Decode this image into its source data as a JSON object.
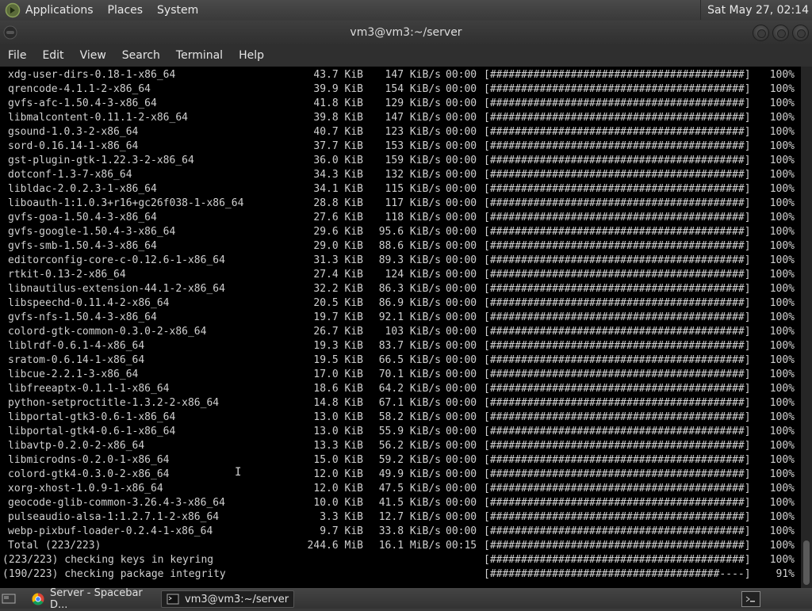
{
  "top_panel": {
    "menus": [
      "Applications",
      "Places",
      "System"
    ],
    "clock": "Sat May 27, 02:14"
  },
  "window": {
    "title": "vm3@vm3:~/server",
    "menu": [
      "File",
      "Edit",
      "View",
      "Search",
      "Terminal",
      "Help"
    ]
  },
  "terminal": {
    "rows": [
      {
        "name": "xdg-user-dirs-0.18-1-x86_64",
        "size": "43.7 KiB",
        "speed": "147 KiB/s",
        "time": "00:00",
        "bar": "[#########################################]",
        "pct": "100%"
      },
      {
        "name": "qrencode-4.1.1-2-x86_64",
        "size": "39.9 KiB",
        "speed": "154 KiB/s",
        "time": "00:00",
        "bar": "[#########################################]",
        "pct": "100%"
      },
      {
        "name": "gvfs-afc-1.50.4-3-x86_64",
        "size": "41.8 KiB",
        "speed": "129 KiB/s",
        "time": "00:00",
        "bar": "[#########################################]",
        "pct": "100%"
      },
      {
        "name": "libmalcontent-0.11.1-2-x86_64",
        "size": "39.8 KiB",
        "speed": "147 KiB/s",
        "time": "00:00",
        "bar": "[#########################################]",
        "pct": "100%"
      },
      {
        "name": "gsound-1.0.3-2-x86_64",
        "size": "40.7 KiB",
        "speed": "123 KiB/s",
        "time": "00:00",
        "bar": "[#########################################]",
        "pct": "100%"
      },
      {
        "name": "sord-0.16.14-1-x86_64",
        "size": "37.7 KiB",
        "speed": "153 KiB/s",
        "time": "00:00",
        "bar": "[#########################################]",
        "pct": "100%"
      },
      {
        "name": "gst-plugin-gtk-1.22.3-2-x86_64",
        "size": "36.0 KiB",
        "speed": "159 KiB/s",
        "time": "00:00",
        "bar": "[#########################################]",
        "pct": "100%"
      },
      {
        "name": "dotconf-1.3-7-x86_64",
        "size": "34.3 KiB",
        "speed": "132 KiB/s",
        "time": "00:00",
        "bar": "[#########################################]",
        "pct": "100%"
      },
      {
        "name": "libldac-2.0.2.3-1-x86_64",
        "size": "34.1 KiB",
        "speed": "115 KiB/s",
        "time": "00:00",
        "bar": "[#########################################]",
        "pct": "100%"
      },
      {
        "name": "liboauth-1:1.0.3+r16+gc26f038-1-x86_64",
        "size": "28.8 KiB",
        "speed": "117 KiB/s",
        "time": "00:00",
        "bar": "[#########################################]",
        "pct": "100%"
      },
      {
        "name": "gvfs-goa-1.50.4-3-x86_64",
        "size": "27.6 KiB",
        "speed": "118 KiB/s",
        "time": "00:00",
        "bar": "[#########################################]",
        "pct": "100%"
      },
      {
        "name": "gvfs-google-1.50.4-3-x86_64",
        "size": "29.6 KiB",
        "speed": "95.6 KiB/s",
        "time": "00:00",
        "bar": "[#########################################]",
        "pct": "100%"
      },
      {
        "name": "gvfs-smb-1.50.4-3-x86_64",
        "size": "29.0 KiB",
        "speed": "88.6 KiB/s",
        "time": "00:00",
        "bar": "[#########################################]",
        "pct": "100%"
      },
      {
        "name": "editorconfig-core-c-0.12.6-1-x86_64",
        "size": "31.3 KiB",
        "speed": "89.3 KiB/s",
        "time": "00:00",
        "bar": "[#########################################]",
        "pct": "100%"
      },
      {
        "name": "rtkit-0.13-2-x86_64",
        "size": "27.4 KiB",
        "speed": "124 KiB/s",
        "time": "00:00",
        "bar": "[#########################################]",
        "pct": "100%"
      },
      {
        "name": "libnautilus-extension-44.1-2-x86_64",
        "size": "32.2 KiB",
        "speed": "86.3 KiB/s",
        "time": "00:00",
        "bar": "[#########################################]",
        "pct": "100%"
      },
      {
        "name": "libspeechd-0.11.4-2-x86_64",
        "size": "20.5 KiB",
        "speed": "86.9 KiB/s",
        "time": "00:00",
        "bar": "[#########################################]",
        "pct": "100%"
      },
      {
        "name": "gvfs-nfs-1.50.4-3-x86_64",
        "size": "19.7 KiB",
        "speed": "92.1 KiB/s",
        "time": "00:00",
        "bar": "[#########################################]",
        "pct": "100%"
      },
      {
        "name": "colord-gtk-common-0.3.0-2-x86_64",
        "size": "26.7 KiB",
        "speed": "103 KiB/s",
        "time": "00:00",
        "bar": "[#########################################]",
        "pct": "100%"
      },
      {
        "name": "liblrdf-0.6.1-4-x86_64",
        "size": "19.3 KiB",
        "speed": "83.7 KiB/s",
        "time": "00:00",
        "bar": "[#########################################]",
        "pct": "100%"
      },
      {
        "name": "sratom-0.6.14-1-x86_64",
        "size": "19.5 KiB",
        "speed": "66.5 KiB/s",
        "time": "00:00",
        "bar": "[#########################################]",
        "pct": "100%"
      },
      {
        "name": "libcue-2.2.1-3-x86_64",
        "size": "17.0 KiB",
        "speed": "70.1 KiB/s",
        "time": "00:00",
        "bar": "[#########################################]",
        "pct": "100%"
      },
      {
        "name": "libfreeaptx-0.1.1-1-x86_64",
        "size": "18.6 KiB",
        "speed": "64.2 KiB/s",
        "time": "00:00",
        "bar": "[#########################################]",
        "pct": "100%"
      },
      {
        "name": "python-setproctitle-1.3.2-2-x86_64",
        "size": "14.8 KiB",
        "speed": "67.1 KiB/s",
        "time": "00:00",
        "bar": "[#########################################]",
        "pct": "100%"
      },
      {
        "name": "libportal-gtk3-0.6-1-x86_64",
        "size": "13.0 KiB",
        "speed": "58.2 KiB/s",
        "time": "00:00",
        "bar": "[#########################################]",
        "pct": "100%"
      },
      {
        "name": "libportal-gtk4-0.6-1-x86_64",
        "size": "13.0 KiB",
        "speed": "55.9 KiB/s",
        "time": "00:00",
        "bar": "[#########################################]",
        "pct": "100%"
      },
      {
        "name": "libavtp-0.2.0-2-x86_64",
        "size": "13.3 KiB",
        "speed": "56.2 KiB/s",
        "time": "00:00",
        "bar": "[#########################################]",
        "pct": "100%"
      },
      {
        "name": "libmicrodns-0.2.0-1-x86_64",
        "size": "15.0 KiB",
        "speed": "59.2 KiB/s",
        "time": "00:00",
        "bar": "[#########################################]",
        "pct": "100%"
      },
      {
        "name": "colord-gtk4-0.3.0-2-x86_64",
        "size": "12.0 KiB",
        "speed": "49.9 KiB/s",
        "time": "00:00",
        "bar": "[#########################################]",
        "pct": "100%"
      },
      {
        "name": "xorg-xhost-1.0.9-1-x86_64",
        "size": "12.0 KiB",
        "speed": "47.5 KiB/s",
        "time": "00:00",
        "bar": "[#########################################]",
        "pct": "100%"
      },
      {
        "name": "geocode-glib-common-3.26.4-3-x86_64",
        "size": "10.0 KiB",
        "speed": "41.5 KiB/s",
        "time": "00:00",
        "bar": "[#########################################]",
        "pct": "100%"
      },
      {
        "name": "pulseaudio-alsa-1:1.2.7.1-2-x86_64",
        "size": "3.3 KiB",
        "speed": "12.7 KiB/s",
        "time": "00:00",
        "bar": "[#########################################]",
        "pct": "100%"
      },
      {
        "name": "webp-pixbuf-loader-0.2.4-1-x86_64",
        "size": "9.7 KiB",
        "speed": "33.8 KiB/s",
        "time": "00:00",
        "bar": "[#########################################]",
        "pct": "100%"
      },
      {
        "name": "Total (223/223)",
        "size": "244.6 MiB",
        "speed": "16.1 MiB/s",
        "time": "00:15",
        "bar": "[#########################################]",
        "pct": "100%"
      }
    ],
    "status_lines": [
      {
        "text": "(223/223) checking keys in keyring",
        "bar": "[#########################################]",
        "pct": "100%"
      },
      {
        "text": "(190/223) checking package integrity",
        "bar": "[#####################################----]",
        "pct": "91%"
      }
    ]
  },
  "taskbar": {
    "tasks": [
      {
        "label": "Server - Spacebar D...",
        "icon": "chrome-icon"
      },
      {
        "label": "vm3@vm3:~/server",
        "icon": "terminal-icon"
      }
    ]
  }
}
